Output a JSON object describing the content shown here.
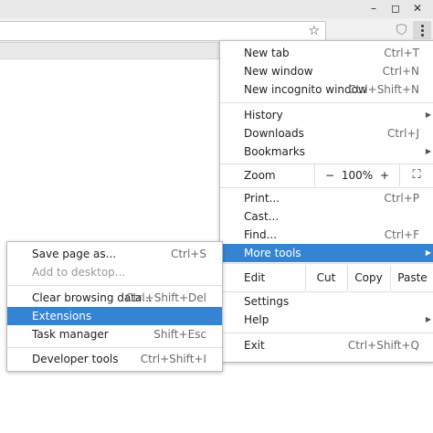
{
  "window": {
    "controls": {
      "minimize": "–",
      "maximize": "◻",
      "close": "✕"
    }
  },
  "toolbar": {
    "bookmark_icon": "☆"
  },
  "main_menu": {
    "new_tab": {
      "label": "New tab",
      "shortcut": "Ctrl+T"
    },
    "new_window": {
      "label": "New window",
      "shortcut": "Ctrl+N"
    },
    "new_incognito": {
      "label": "New incognito window",
      "shortcut": "Ctrl+Shift+N"
    },
    "history": {
      "label": "History"
    },
    "downloads": {
      "label": "Downloads",
      "shortcut": "Ctrl+J"
    },
    "bookmarks": {
      "label": "Bookmarks"
    },
    "zoom": {
      "label": "Zoom",
      "minus": "−",
      "value": "100%",
      "plus": "+",
      "fullscreen": "⛶"
    },
    "print": {
      "label": "Print...",
      "shortcut": "Ctrl+P"
    },
    "cast": {
      "label": "Cast..."
    },
    "find": {
      "label": "Find...",
      "shortcut": "Ctrl+F"
    },
    "more_tools": {
      "label": "More tools"
    },
    "edit": {
      "label": "Edit",
      "cut": "Cut",
      "copy": "Copy",
      "paste": "Paste"
    },
    "settings": {
      "label": "Settings"
    },
    "help": {
      "label": "Help"
    },
    "exit": {
      "label": "Exit",
      "shortcut": "Ctrl+Shift+Q"
    },
    "submenu_arrow": "▶"
  },
  "more_tools_menu": {
    "save_page": {
      "label": "Save page as...",
      "shortcut": "Ctrl+S"
    },
    "add_to_desktop": {
      "label": "Add to desktop..."
    },
    "clear_browsing": {
      "label": "Clear browsing data...",
      "shortcut": "Ctrl+Shift+Del"
    },
    "extensions": {
      "label": "Extensions"
    },
    "task_manager": {
      "label": "Task manager",
      "shortcut": "Shift+Esc"
    },
    "developer_tools": {
      "label": "Developer tools",
      "shortcut": "Ctrl+Shift+I"
    }
  },
  "colors": {
    "highlight": "#3584d4",
    "menu_background": "#ffffff",
    "shortcut_text": "#6b6b6b"
  }
}
